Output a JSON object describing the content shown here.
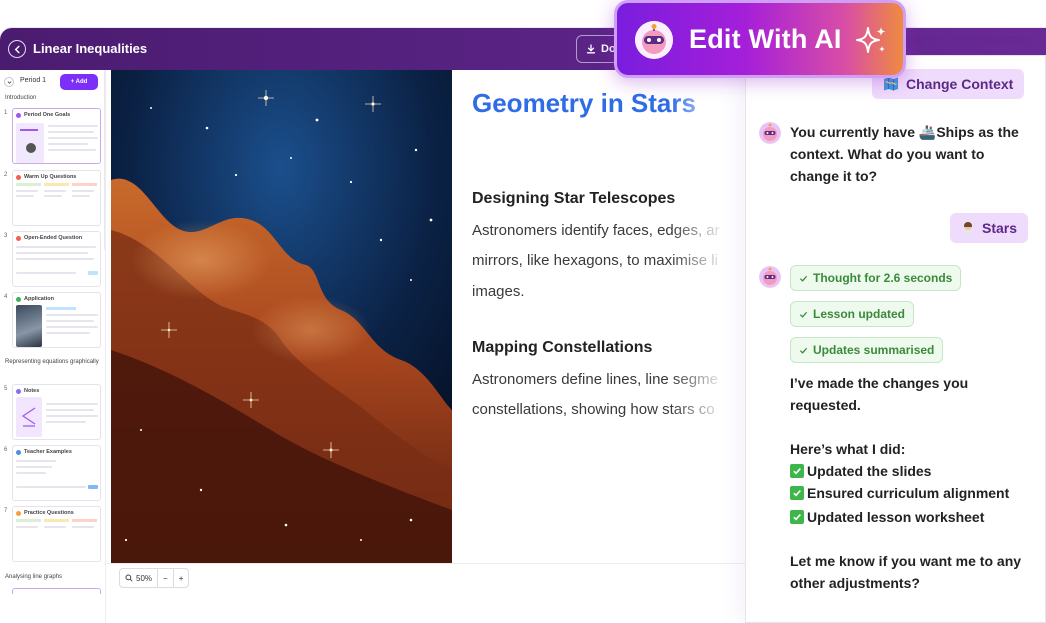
{
  "app": {
    "title": "Linear Inequalities",
    "download_label": "Do"
  },
  "sidebar": {
    "period_label": "Period 1",
    "add_label": "+ Add",
    "sections": [
      "Introduction",
      "Representing equations graphically",
      "Analysing line graphs"
    ],
    "slides": [
      {
        "num": "1",
        "title": "Period One Goals",
        "color": "#9b59f0"
      },
      {
        "num": "2",
        "title": "Warm Up Questions",
        "color": "#f0604d"
      },
      {
        "num": "3",
        "title": "Open-Ended Question",
        "color": "#f0604d"
      },
      {
        "num": "4",
        "title": "Application",
        "color": "#38b35a"
      },
      {
        "num": "5",
        "title": "Notes",
        "color": "#8b6cf0"
      },
      {
        "num": "6",
        "title": "Teacher Examples",
        "color": "#4a90e2"
      },
      {
        "num": "7",
        "title": "Practice Questions",
        "color": "#f3a03a"
      }
    ]
  },
  "slide": {
    "title": "Geometry in Stars",
    "heading1": "Designing Star Telescopes",
    "para1_line1": "Astronomers identify faces, edges, ar",
    "para1_line2": "mirrors, like hexagons, to maximise li",
    "para1_line3": "images.",
    "heading2": "Mapping Constellations",
    "para2_line1": "Astronomers define lines, line segme",
    "para2_line2": "constellations, showing how stars co"
  },
  "zoom": {
    "level": "50%",
    "minus": "−",
    "plus": "+"
  },
  "ai_button": {
    "label": "Edit With AI"
  },
  "chat": {
    "change_context_label": "Change Context",
    "msg1_line1": "You currently have 🚢Ships as the",
    "msg1_line2": "context. What do you want to",
    "msg1_line3": "change it to?",
    "user_reply": "Stars",
    "status1": "Thought for 2.6 seconds",
    "status2": "Lesson updated",
    "status3": "Updates summarised",
    "reply_line1": "I’ve made the changes you",
    "reply_line2": "requested.",
    "did_heading": "Here’s what I did:",
    "did_items": [
      "Updated the slides",
      "Ensured curriculum alignment",
      "Updated lesson worksheet"
    ],
    "closing_line1": "Let me know if you want me to any",
    "closing_line2": "other adjustments?"
  }
}
